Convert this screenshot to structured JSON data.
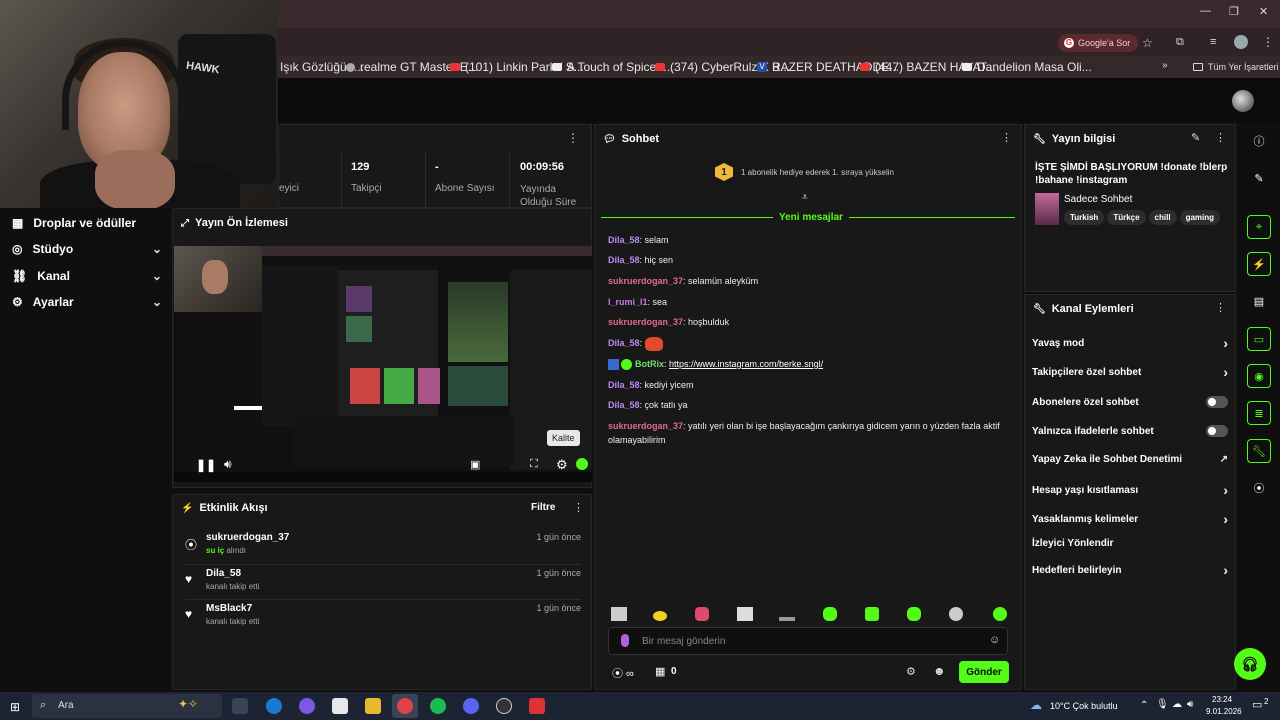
{
  "browser": {
    "google_sor": "Google'a Sor",
    "window_min": "—",
    "window_restore": "❐",
    "window_close": "✕",
    "bookmarks": [
      {
        "label": "Işık Gözlüğü -...",
        "icon": "globe-icon"
      },
      {
        "label": "realme GT Master E...",
        "icon": "globe-icon"
      },
      {
        "label": "(101) Linkin Park / S...",
        "icon": "youtube-icon"
      },
      {
        "label": "A Touch of Spice -...",
        "icon": "page-icon"
      },
      {
        "label": "(374) CyberRulz X B...",
        "icon": "youtube-icon"
      },
      {
        "label": "RAZER DEATHADDE...",
        "icon": "v-icon"
      },
      {
        "label": "(447) BAZEN HAYAT...",
        "icon": "youtube-icon"
      },
      {
        "label": "Dandelion Masa Oli...",
        "icon": "page-icon"
      }
    ],
    "bookmarks_more": "»",
    "all_bookmarks": "Tüm Yer İşaretleri"
  },
  "webcam": {
    "chair_text": "HAWK"
  },
  "stats": {
    "items": [
      {
        "value": "",
        "label": "eyici"
      },
      {
        "value": "129",
        "label": "Takipçi"
      },
      {
        "value": "-",
        "label": "Abone Sayısı"
      },
      {
        "value": "00:09:56",
        "label": "Yayında Olduğu Süre"
      }
    ]
  },
  "sidebar": {
    "items": [
      {
        "label": "Droplar ve ödüller",
        "icon": "gift-icon",
        "chevron": false
      },
      {
        "label": "Stüdyo",
        "icon": "studio-icon",
        "chevron": true
      },
      {
        "label": "Kanal",
        "icon": "channel-icon",
        "chevron": true
      },
      {
        "label": "Ayarlar",
        "icon": "gear-icon",
        "chevron": true
      }
    ]
  },
  "preview": {
    "title": "Yayın Ön İzlemesi",
    "tooltip": "Kalite"
  },
  "activity": {
    "title": "Etkinlik Akışı",
    "filter": "Filtre",
    "items": [
      {
        "user": "sukruerdogan_37",
        "event_prefix": "su iç",
        "event_suffix": " alındı",
        "time": "1 gün önce",
        "icon": "drops-icon"
      },
      {
        "user": "Dila_58",
        "event_prefix": "",
        "event_suffix": "kanalı takip etti",
        "time": "1 gün önce",
        "icon": "heart-icon"
      },
      {
        "user": "MsBlack7",
        "event_prefix": "",
        "event_suffix": "kanalı takip etti",
        "time": "1 gün önce",
        "icon": "heart-icon"
      }
    ]
  },
  "chat": {
    "title": "Sohbet",
    "gift_banner": "1 abonelik hediye ederek 1. sıraya yükselin",
    "gift_rank": "1",
    "new_messages": "Yeni mesajlar",
    "messages": [
      {
        "user": "Dila_58",
        "text": "selam",
        "color": "purple"
      },
      {
        "user": "Dila_58",
        "text": "hiç sen",
        "color": "purple"
      },
      {
        "user": "sukruerdogan_37",
        "text": "selamün aleyküm",
        "color": "red"
      },
      {
        "user": "I_rumi_l1",
        "text": "sea",
        "color": "pink"
      },
      {
        "user": "sukruerdogan_37",
        "text": "hoşbulduk",
        "color": "red"
      },
      {
        "user": "Dila_58",
        "text": "",
        "color": "purple",
        "emote": true
      },
      {
        "user": "BotRix",
        "text": "https://www.instagram.com/berke.sngl/",
        "color": "bot"
      },
      {
        "user": "Dila_58",
        "text": "kediyi yicem",
        "color": "purple"
      },
      {
        "user": "Dila_58",
        "text": "çok tatlı ya",
        "color": "purple"
      },
      {
        "user": "sukruerdogan_37",
        "text": "yatılı yeri olan bi işe başlayacağım çankırıya gidicem yarın o yüzden fazla aktif olamayabilirim",
        "color": "red"
      }
    ],
    "input_placeholder": "Bir mesaj gönderin",
    "points": "0",
    "send": "Gönder"
  },
  "stream_info": {
    "title": "Yayın bilgisi",
    "stream_title": "İŞTE ŞİMDİ BAŞLIYORUM !donate !blerp !bahane !instagram",
    "category": "Sadece Sohbet",
    "tags": [
      "Turkish",
      "Türkçe",
      "chill",
      "gaming"
    ]
  },
  "channel_actions": {
    "title": "Kanal Eylemleri",
    "items": [
      {
        "label": "Yavaş mod",
        "control": "arrow"
      },
      {
        "label": "Takipçilere özel sohbet",
        "control": "arrow"
      },
      {
        "label": "Abonelere özel sohbet",
        "control": "toggle"
      },
      {
        "label": "Yalnızca ifadelerle sohbet",
        "control": "toggle"
      },
      {
        "label": "Yapay Zeka ile Sohbet Denetimi",
        "control": "external"
      },
      {
        "label": "Hesap yaşı kısıtlaması",
        "control": "arrow"
      },
      {
        "label": "Yasaklanmış kelimeler",
        "control": "arrow"
      },
      {
        "label": "İzleyici Yönlendir",
        "control": "none"
      },
      {
        "label": "Hedefleri belirleyin",
        "control": "arrow"
      }
    ]
  },
  "taskbar": {
    "search": "Ara",
    "weather": "10°C  Çok bulutlu",
    "time": "23:24",
    "date": "9.01.2026",
    "notif": "2"
  },
  "colors": {
    "accent": "#53fc18",
    "bg": "#0f0f0f",
    "panel": "#181818"
  }
}
